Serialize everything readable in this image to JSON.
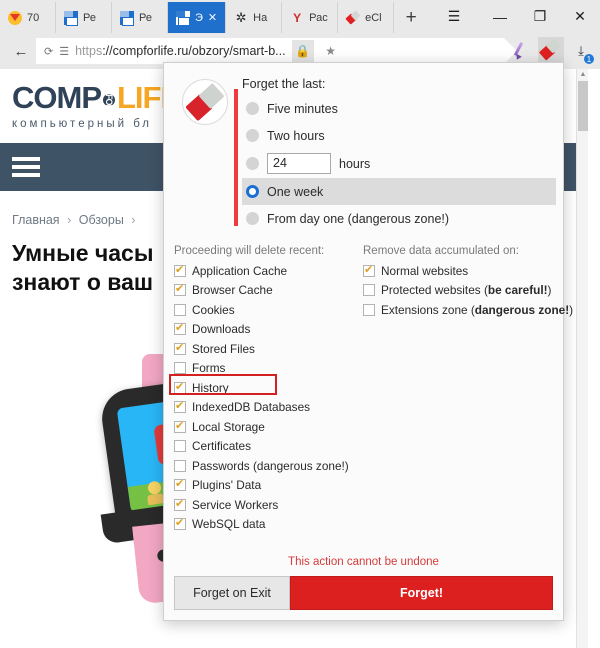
{
  "browser": {
    "tabs": [
      {
        "label": "70",
        "icon": "yandex-logo-icon",
        "active": false,
        "closable": false
      },
      {
        "label": "Ре",
        "icon": "page-icon",
        "active": false,
        "closable": false
      },
      {
        "label": "Ре",
        "icon": "page-icon",
        "active": false,
        "closable": false
      },
      {
        "label": "Э",
        "icon": "page-icon",
        "active": true,
        "closable": true
      },
      {
        "label": "На",
        "icon": "gear-icon",
        "active": false,
        "closable": false
      },
      {
        "label": "Рас",
        "icon": "yandex-browser-icon",
        "active": false,
        "closable": false
      },
      {
        "label": "eCl",
        "icon": "eraser-icon",
        "active": false,
        "closable": false
      }
    ],
    "new_tab_label": "+",
    "close_tab_label": "✕",
    "window_controls": {
      "menu": "☰",
      "minimize": "—",
      "maximize": "❐",
      "close": "✕"
    },
    "nav": {
      "back_label": "←",
      "reload_label": "⟳",
      "reader_label": "☰",
      "url_scheme": "https",
      "url_rest": "://compforlife.ru/obzory/smart-b...",
      "url_full": "https://compforlife.ru/obzory/smart-b...",
      "shield_label": "🔒",
      "bookmark_label": "★"
    },
    "toolbar_icons": [
      {
        "name": "pen-icon",
        "active": false
      },
      {
        "name": "eraser-icon",
        "active": true
      },
      {
        "name": "download-icon",
        "active": false,
        "badge": "1"
      }
    ]
  },
  "page": {
    "logo": {
      "part1": "COMP",
      "part2": "LIFE",
      "part3": "R",
      "for": "FOR"
    },
    "tagline": "компьютерный бл",
    "breadcrumb": {
      "items": [
        "Главная",
        "Обзоры"
      ],
      "separator": "›"
    },
    "headline_line1": "Умные часы",
    "headline_line2": "знают о ваш"
  },
  "dialog": {
    "eraser_icon": "eraser-icon",
    "forget_title": "Forget the last:",
    "time_options": [
      {
        "label": "Five minutes",
        "selected": false
      },
      {
        "label": "Two hours",
        "selected": false
      },
      {
        "label": "One week",
        "selected": true
      },
      {
        "label": "From day one (dangerous zone!)",
        "selected": false
      }
    ],
    "hours": {
      "value": "24",
      "suffix": "hours",
      "selected": false
    },
    "left_column": {
      "header": "Proceeding will delete recent:",
      "items": [
        {
          "label": "Application Cache",
          "checked": true
        },
        {
          "label": "Browser Cache",
          "checked": true
        },
        {
          "label": "Cookies",
          "checked": false
        },
        {
          "label": "Downloads",
          "checked": true
        },
        {
          "label": "Stored Files",
          "checked": true
        },
        {
          "label": "Forms",
          "checked": false
        },
        {
          "label": "History",
          "checked": true,
          "highlighted": true
        },
        {
          "label": "IndexedDB Databases",
          "checked": true
        },
        {
          "label": "Local Storage",
          "checked": true
        },
        {
          "label": "Certificates",
          "checked": false
        },
        {
          "label": "Passwords (dangerous zone!)",
          "checked": false
        },
        {
          "label": "Plugins' Data",
          "checked": true
        },
        {
          "label": "Service Workers",
          "checked": true
        },
        {
          "label": "WebSQL data",
          "checked": true
        }
      ]
    },
    "right_column": {
      "header": "Remove data accumulated on:",
      "items": [
        {
          "label": "Normal websites",
          "label_plain": "Normal websites",
          "bold": "",
          "checked": true
        },
        {
          "label": "Protected websites (be careful!)",
          "label_plain": "Protected websites (",
          "bold": "be careful!",
          "tail": ")",
          "checked": false
        },
        {
          "label": "Extensions zone (dangerous zone!)",
          "label_plain": "Extensions zone (",
          "bold": "dangerous zone!",
          "tail": ")",
          "checked": false
        }
      ]
    },
    "warning": "This action cannot be undone",
    "buttons": {
      "forget_on_exit": "Forget on Exit",
      "forget": "Forget!"
    }
  },
  "colors": {
    "accent_red": "#dc1f1f",
    "red_bar": "#ef3b3b",
    "tab_active_blue": "#1f6fcc",
    "radio_blue": "#1a6fd4",
    "check_gold": "#e0a020",
    "site_navy": "#3f5366",
    "highlight_red": "#d32020"
  }
}
